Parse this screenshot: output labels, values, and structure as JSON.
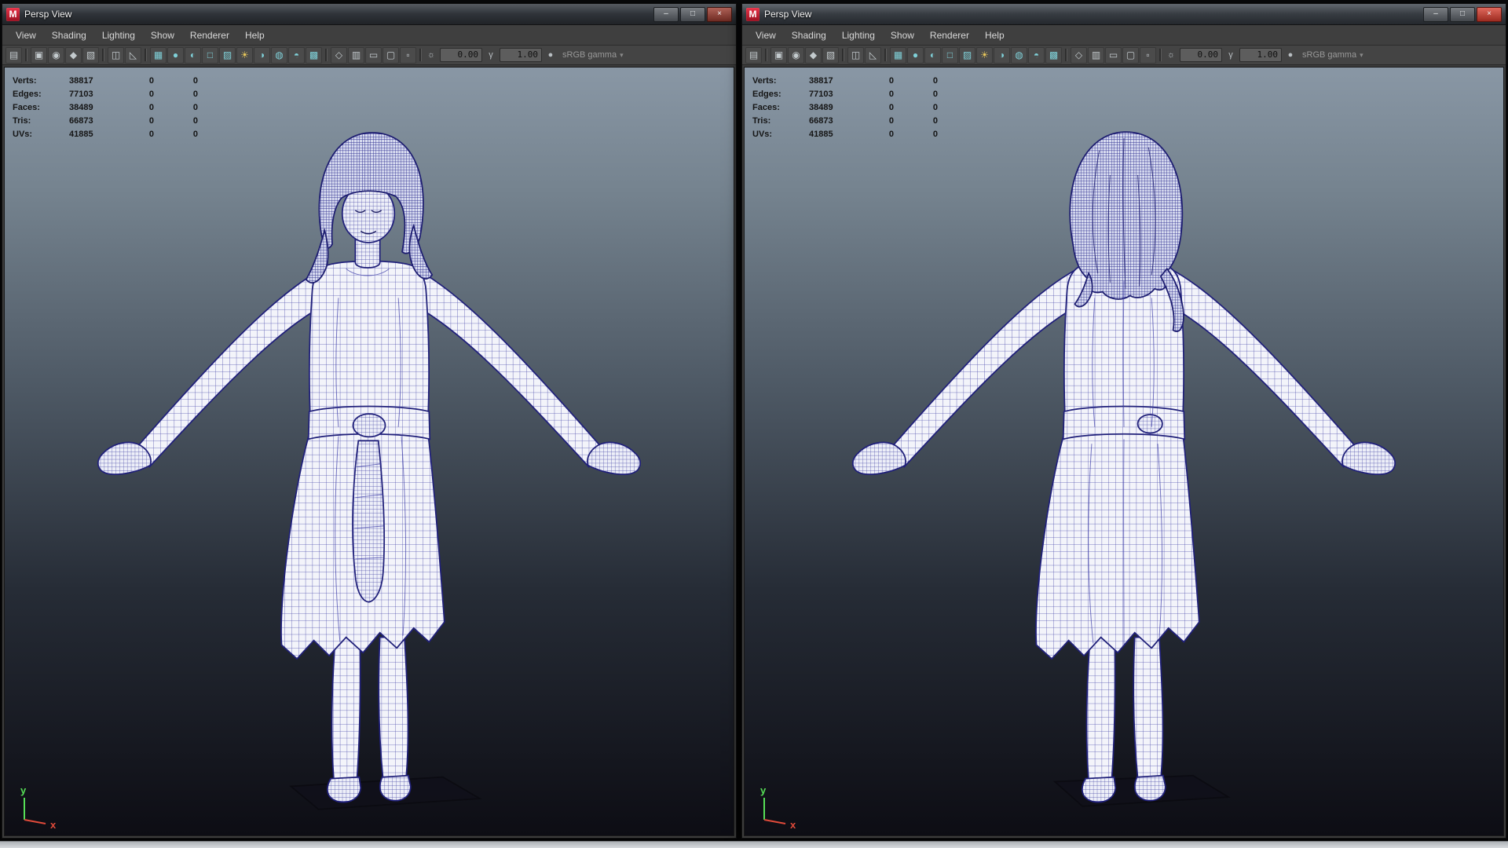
{
  "colors": {
    "maya_red": "#c2152c",
    "wireframe": "#20207a",
    "viewport_top": "#8997a5",
    "viewport_bottom": "#0d0d14",
    "axis_x": "#e04a3a",
    "axis_y": "#57e057"
  },
  "toolbar_icons": [
    {
      "name": "panel-menu-icon",
      "glyph": "▤",
      "tone": "gray"
    },
    {
      "name": "toolbar-separator",
      "glyph": "",
      "tone": "sep"
    },
    {
      "name": "select-camera-icon",
      "glyph": "▣",
      "tone": "gray"
    },
    {
      "name": "camera-attributes-icon",
      "glyph": "◉",
      "tone": "gray"
    },
    {
      "name": "bookmark-icon",
      "glyph": "◆",
      "tone": "gray"
    },
    {
      "name": "image-plane-icon",
      "glyph": "▧",
      "tone": "gray"
    },
    {
      "name": "toolbar-separator",
      "glyph": "",
      "tone": "sep"
    },
    {
      "name": "two-d-pan-zoom-icon",
      "glyph": "◫",
      "tone": "gray"
    },
    {
      "name": "grease-pencil-icon",
      "glyph": "◺",
      "tone": "gray"
    },
    {
      "name": "toolbar-separator",
      "glyph": "",
      "tone": "sep"
    },
    {
      "name": "wireframe-icon",
      "glyph": "▦",
      "tone": "teal"
    },
    {
      "name": "smooth-shade-icon",
      "glyph": "●",
      "tone": "teal"
    },
    {
      "name": "flat-shade-icon",
      "glyph": "◐",
      "tone": "teal"
    },
    {
      "name": "bounding-box-icon",
      "glyph": "□",
      "tone": "teal"
    },
    {
      "name": "textured-icon",
      "glyph": "▨",
      "tone": "teal"
    },
    {
      "name": "lights-icon",
      "glyph": "☀",
      "tone": "amber"
    },
    {
      "name": "shadows-icon",
      "glyph": "◑",
      "tone": "teal"
    },
    {
      "name": "occlusion-icon",
      "glyph": "◍",
      "tone": "teal"
    },
    {
      "name": "motion-blur-icon",
      "glyph": "◓",
      "tone": "teal"
    },
    {
      "name": "multisample-icon",
      "glyph": "▩",
      "tone": "teal"
    },
    {
      "name": "toolbar-separator",
      "glyph": "",
      "tone": "sep"
    },
    {
      "name": "isolate-select-icon",
      "glyph": "◇",
      "tone": "gray"
    },
    {
      "name": "field-chart-icon",
      "glyph": "▥",
      "tone": "gray"
    },
    {
      "name": "gate-mask-icon",
      "glyph": "▭",
      "tone": "gray"
    },
    {
      "name": "safe-action-icon",
      "glyph": "▢",
      "tone": "gray"
    },
    {
      "name": "safe-title-icon",
      "glyph": "▫",
      "tone": "gray"
    },
    {
      "name": "toolbar-separator",
      "glyph": "",
      "tone": "sep"
    }
  ],
  "windows": [
    {
      "logo_letter": "M",
      "title": "Persp View",
      "controls": {
        "minimize": "–",
        "maximize": "□",
        "close": "×"
      },
      "menu": [
        {
          "name": "menu-view",
          "label": "View"
        },
        {
          "name": "menu-shading",
          "label": "Shading"
        },
        {
          "name": "menu-lighting",
          "label": "Lighting"
        },
        {
          "name": "menu-show",
          "label": "Show"
        },
        {
          "name": "menu-renderer",
          "label": "Renderer"
        },
        {
          "name": "menu-help",
          "label": "Help"
        }
      ],
      "toolbar": {
        "exposure_icon": "☼",
        "exposure": "0.00",
        "gamma_icon": "γ",
        "gamma": "1.00",
        "color_icon": "●",
        "color_label": "sRGB gamma",
        "chevron": "▾"
      },
      "hud": {
        "rows": [
          {
            "label": "Verts:",
            "value": "38817",
            "c2": "0",
            "c3": "0"
          },
          {
            "label": "Edges:",
            "value": "77103",
            "c2": "0",
            "c3": "0"
          },
          {
            "label": "Faces:",
            "value": "38489",
            "c2": "0",
            "c3": "0"
          },
          {
            "label": "Tris:",
            "value": "66873",
            "c2": "0",
            "c3": "0"
          },
          {
            "label": "UVs:",
            "value": "41885",
            "c2": "0",
            "c3": "0"
          }
        ]
      },
      "axis": {
        "x": "x",
        "y": "y"
      }
    },
    {
      "logo_letter": "M",
      "title": "Persp View",
      "controls": {
        "minimize": "–",
        "maximize": "□",
        "close": "×"
      },
      "menu": [
        {
          "name": "menu-view",
          "label": "View"
        },
        {
          "name": "menu-shading",
          "label": "Shading"
        },
        {
          "name": "menu-lighting",
          "label": "Lighting"
        },
        {
          "name": "menu-show",
          "label": "Show"
        },
        {
          "name": "menu-renderer",
          "label": "Renderer"
        },
        {
          "name": "menu-help",
          "label": "Help"
        }
      ],
      "toolbar": {
        "exposure_icon": "☼",
        "exposure": "0.00",
        "gamma_icon": "γ",
        "gamma": "1.00",
        "color_icon": "●",
        "color_label": "sRGB gamma",
        "chevron": "▾"
      },
      "hud": {
        "rows": [
          {
            "label": "Verts:",
            "value": "38817",
            "c2": "0",
            "c3": "0"
          },
          {
            "label": "Edges:",
            "value": "77103",
            "c2": "0",
            "c3": "0"
          },
          {
            "label": "Faces:",
            "value": "38489",
            "c2": "0",
            "c3": "0"
          },
          {
            "label": "Tris:",
            "value": "66873",
            "c2": "0",
            "c3": "0"
          },
          {
            "label": "UVs:",
            "value": "41885",
            "c2": "0",
            "c3": "0"
          }
        ]
      },
      "axis": {
        "x": "x",
        "y": "y"
      }
    }
  ]
}
